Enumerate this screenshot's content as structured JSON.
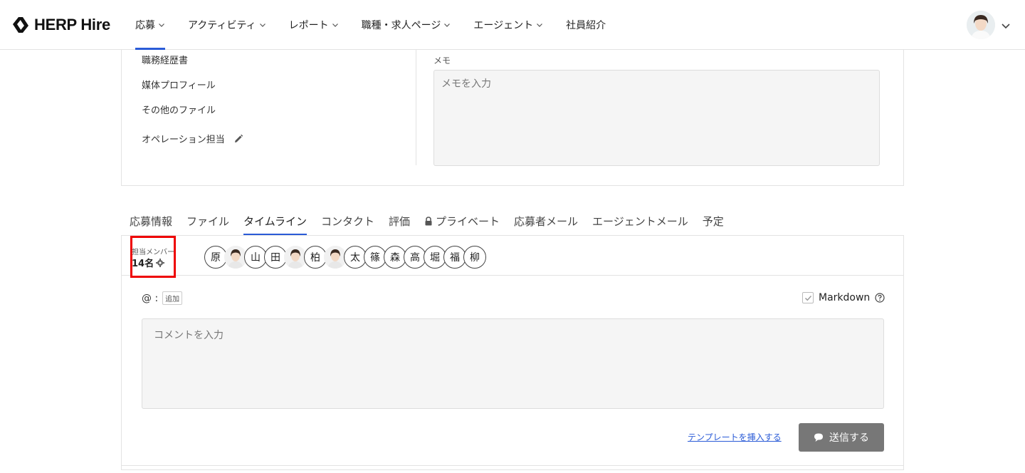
{
  "header": {
    "logo": "HERP Hire",
    "nav": [
      {
        "label": "応募",
        "has_menu": true,
        "active": true
      },
      {
        "label": "アクティビティ",
        "has_menu": true
      },
      {
        "label": "レポート",
        "has_menu": true
      },
      {
        "label": "職種・求人ページ",
        "has_menu": true
      },
      {
        "label": "エージェント",
        "has_menu": true
      },
      {
        "label": "社員紹介",
        "has_menu": false
      }
    ]
  },
  "upper": {
    "items": [
      "職務経歴書",
      "媒体プロフィール",
      "その他のファイル"
    ],
    "operation_label": "オペレーション担当",
    "memo_label": "メモ",
    "memo_placeholder": "メモを入力"
  },
  "tabs": [
    "応募情報",
    "ファイル",
    "タイムライン",
    "コンタクト",
    "評価",
    "プライベート",
    "応募者メール",
    "エージェントメール",
    "予定"
  ],
  "active_tab": "タイムライン",
  "members": {
    "label": "担当メンバー",
    "count": "14名",
    "avatars": [
      "原",
      "photo",
      "山",
      "田",
      "photo",
      "柏",
      "photo",
      "太",
      "篠",
      "森",
      "高",
      "堀",
      "福",
      "柳"
    ]
  },
  "comment": {
    "mention_prefix": "@ :",
    "add_label": "追加",
    "markdown_label": "Markdown",
    "placeholder": "コメントを入力",
    "template_link": "テンプレートを挿入する",
    "send_label": "送信する"
  },
  "colors": {
    "accent": "#2a5bd7",
    "highlight": "#e00000",
    "send_button": "#777777"
  }
}
